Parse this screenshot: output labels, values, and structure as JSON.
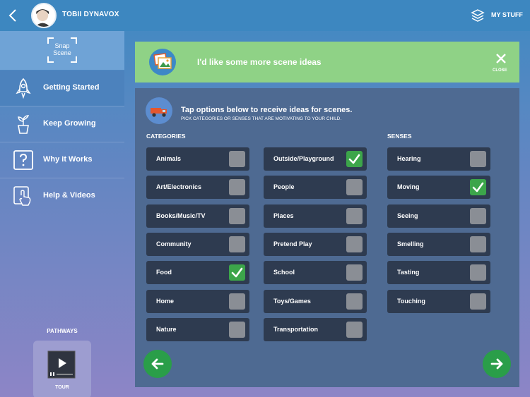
{
  "header": {
    "user_name": "TOBII DYNAVOX",
    "my_stuff_label": "MY STUFF"
  },
  "sidebar": {
    "logo_text_line1": "Snap",
    "logo_text_line2": "Scene",
    "items": [
      {
        "label": "Getting Started",
        "icon": "rocket-icon",
        "active": true
      },
      {
        "label": "Keep Growing",
        "icon": "plant-icon",
        "active": false
      },
      {
        "label": "Why it Works",
        "icon": "question-icon",
        "active": false
      },
      {
        "label": "Help & Videos",
        "icon": "touch-screen-icon",
        "active": false
      }
    ],
    "pathways_label": "PATHWAYS",
    "tour_label": "TOUR"
  },
  "banner": {
    "title": "I'd like some more scene ideas",
    "close_label": "CLOSE",
    "color": "#8fd286"
  },
  "panel": {
    "instruction_title": "Tap options below to receive ideas for scenes.",
    "instruction_sub": "PICK CATEGORIES OR SENSES THAT ARE MOTIVATING TO YOUR CHILD.",
    "categories_heading": "CATEGORIES",
    "senses_heading": "SENSES",
    "categories_col1": [
      {
        "label": "Animals",
        "checked": false
      },
      {
        "label": "Art/Electronics",
        "checked": false
      },
      {
        "label": "Books/Music/TV",
        "checked": false
      },
      {
        "label": "Community",
        "checked": false
      },
      {
        "label": "Food",
        "checked": true
      },
      {
        "label": "Home",
        "checked": false
      },
      {
        "label": "Nature",
        "checked": false
      }
    ],
    "categories_col2": [
      {
        "label": "Outside/Playground",
        "checked": true
      },
      {
        "label": "People",
        "checked": false
      },
      {
        "label": "Places",
        "checked": false
      },
      {
        "label": "Pretend Play",
        "checked": false
      },
      {
        "label": "School",
        "checked": false
      },
      {
        "label": "Toys/Games",
        "checked": false
      },
      {
        "label": "Transportation",
        "checked": false
      }
    ],
    "senses": [
      {
        "label": "Hearing",
        "checked": false
      },
      {
        "label": "Moving",
        "checked": true
      },
      {
        "label": "Seeing",
        "checked": false
      },
      {
        "label": "Smelling",
        "checked": false
      },
      {
        "label": "Tasting",
        "checked": false
      },
      {
        "label": "Touching",
        "checked": false
      }
    ]
  },
  "colors": {
    "accent_green": "#2a9e49",
    "check_green": "#3ca54a",
    "option_bg": "#2e3b50",
    "panel_bg": "#4e6a92"
  }
}
